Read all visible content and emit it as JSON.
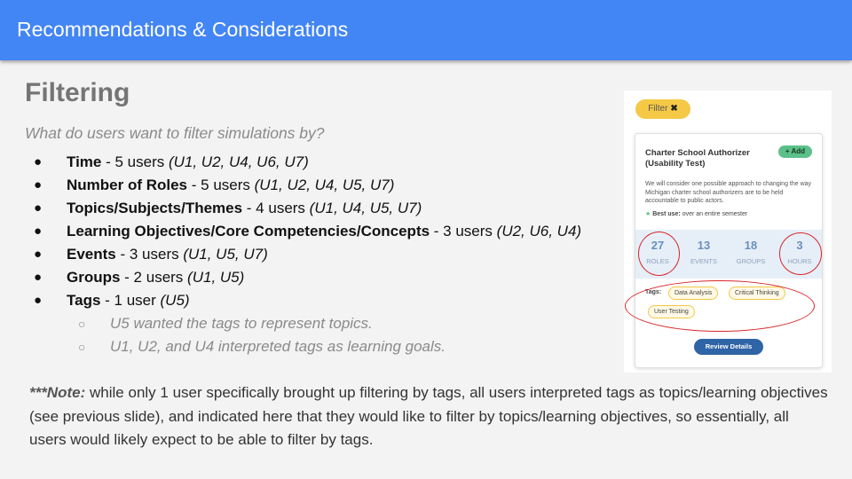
{
  "header": {
    "title": "Recommendations & Considerations"
  },
  "slide": {
    "title": "Filtering",
    "subtitle": "What do users want to filter simulations by?",
    "bullets": [
      {
        "label": "Time",
        "count": " - 5 users ",
        "users": "(U1, U2, U4, U6, U7)"
      },
      {
        "label": "Number of Roles",
        "count": " - 5 users ",
        "users": "(U1, U2, U4, U5, U7)"
      },
      {
        "label": "Topics/Subjects/Themes",
        "count": " - 4 users ",
        "users": "(U1, U4, U5, U7)"
      },
      {
        "label": "Learning Objectives/Core Competencies/Concepts",
        "count": " - 3 users ",
        "users": "(U2, U6, U4)"
      },
      {
        "label": "Events",
        "count": " - 3 users ",
        "users": "(U1, U5, U7)"
      },
      {
        "label": "Groups",
        "count": " - 2 users ",
        "users": "(U1, U5)"
      },
      {
        "label": "Tags",
        "count": " - 1 user ",
        "users": "(U5)"
      }
    ],
    "sub_bullets": [
      "U5 wanted the tags to represent topics.",
      "U1, U2, and U4 interpreted tags as learning goals."
    ],
    "note": {
      "prefix": "***Note:",
      "text": " while only 1 user specifically brought up filtering by tags, all users interpreted tags as topics/learning objectives (see previous slide), and indicated here that they would like to filter by topics/learning objectives, so essentially, all users would likely expect to be able to filter by tags."
    }
  },
  "mock": {
    "filter_label": "Filter",
    "filter_close": "✖",
    "card_title": "Charter School Authorizer (Usability Test)",
    "add_label": "+ Add",
    "description": "We will consider one possible approach to changing the way Michigan charter school authorizers are to be held accountable to public actors.",
    "best_use_label": "Best use:",
    "best_use_value": " over an entire semester",
    "stats": [
      {
        "num": "27",
        "label": "ROLES"
      },
      {
        "num": "13",
        "label": "EVENTS"
      },
      {
        "num": "18",
        "label": "GROUPS"
      },
      {
        "num": "3",
        "label": "HOURS"
      }
    ],
    "tags_label": "Tags:",
    "tags": [
      "Data Analysis",
      "Critical Thinking",
      "User Testing"
    ],
    "review_label": "Review Details",
    "colors": {
      "header": "#4285f4",
      "highlight": "#d9262b",
      "tag_border": "#f0c84a",
      "button": "#2f64a6"
    }
  }
}
